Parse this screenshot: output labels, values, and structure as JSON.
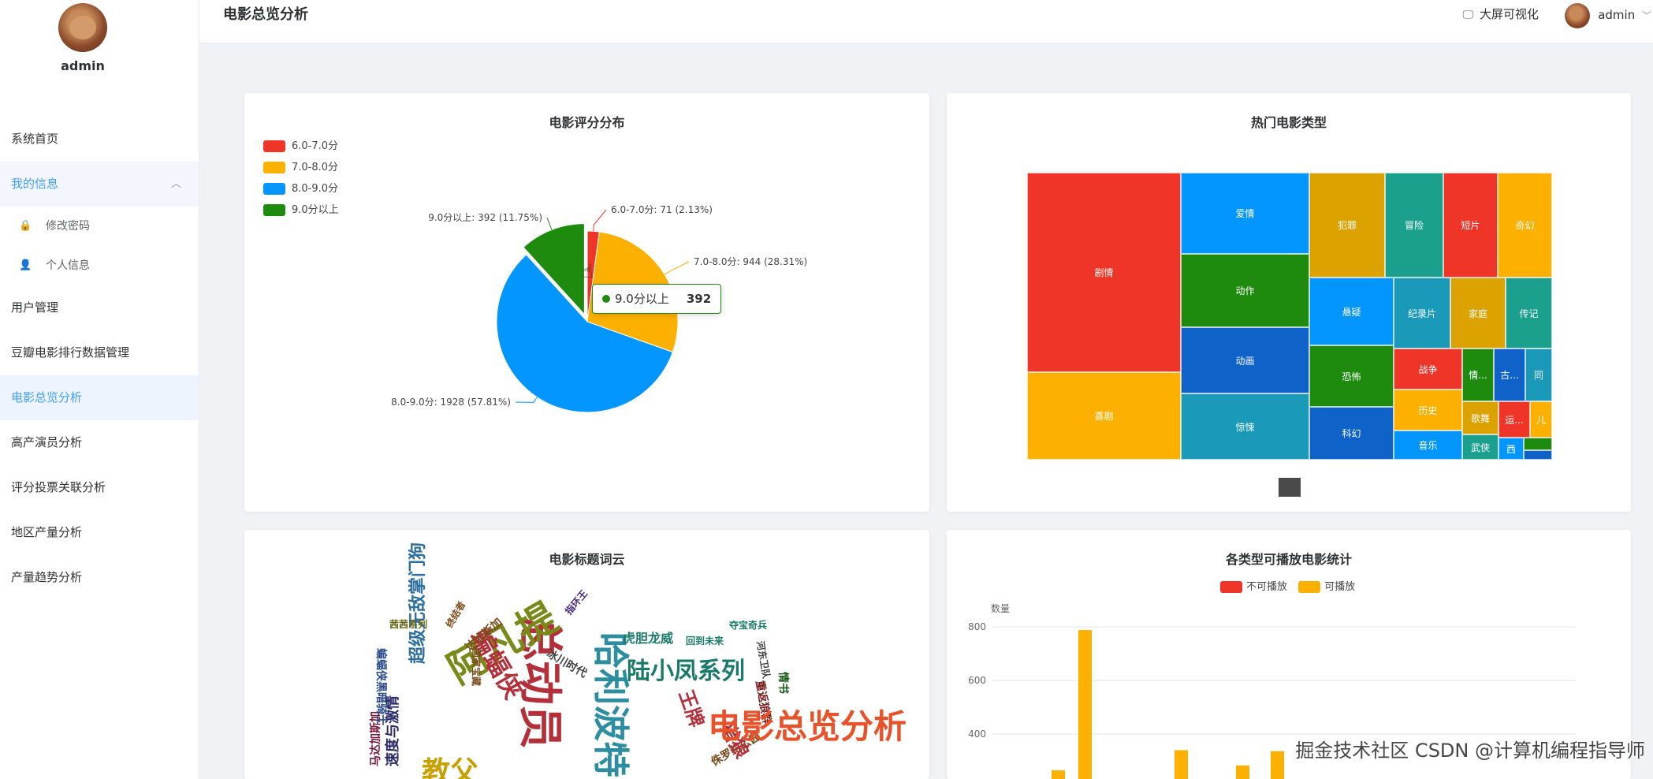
{
  "sidebar": {
    "username": "admin",
    "menu": [
      {
        "label": "系统首页"
      },
      {
        "label": "我的信息"
      },
      {
        "label": "修改密码"
      },
      {
        "label": "个人信息"
      },
      {
        "label": "用户管理"
      },
      {
        "label": "豆瓣电影排行数据管理"
      },
      {
        "label": "电影总览分析"
      },
      {
        "label": "高产演员分析"
      },
      {
        "label": "评分投票关联分析"
      },
      {
        "label": "地区产量分析"
      },
      {
        "label": "产量趋势分析"
      }
    ]
  },
  "header": {
    "title": "电影总览分析",
    "bigscreen_label": "大屏可视化",
    "username": "admin"
  },
  "charts": {
    "rating_title": "电影评分分布",
    "treemap_title": "热门电影类型",
    "wordcloud_title": "电影标题词云",
    "bar_title": "各类型可播放电影统计"
  },
  "chart_data": [
    {
      "type": "pie",
      "title": "电影评分分布",
      "legend": [
        "6.0-7.0分",
        "7.0-8.0分",
        "8.0-9.0分",
        "9.0分以上"
      ],
      "slices": [
        {
          "name": "6.0-7.0分",
          "value": 71,
          "percent": 2.13,
          "color": "#ee3527",
          "label": "6.0-7.0分: 71 (2.13%)"
        },
        {
          "name": "7.0-8.0分",
          "value": 944,
          "percent": 28.31,
          "color": "#fcb100",
          "label": "7.0-8.0分: 944 (28.31%)"
        },
        {
          "name": "8.0-9.0分",
          "value": 1928,
          "percent": 57.81,
          "color": "#0496ff",
          "label": "8.0-9.0分: 1928 (57.81%)"
        },
        {
          "name": "9.0分以上",
          "value": 392,
          "percent": 11.75,
          "color": "#1e8b0f",
          "label": "9.0分以上: 392 (11.75%)"
        }
      ],
      "tooltip": {
        "name": "9.0分以上",
        "value": "392"
      }
    },
    {
      "type": "treemap",
      "title": "热门电影类型",
      "items": [
        "剧情",
        "喜剧",
        "爱情",
        "动作",
        "动画",
        "惊悚",
        "犯罪",
        "冒险",
        "短片",
        "奇幻",
        "悬疑",
        "纪录片",
        "家庭",
        "传记",
        "恐怖",
        "科幻",
        "战争",
        "历史",
        "情...",
        "古...",
        "同",
        "音乐",
        "歌舞",
        "运...",
        "儿",
        "武侠",
        "西"
      ]
    },
    {
      "type": "wordcloud",
      "title": "电影标题词云",
      "words": [
        "总动员",
        "哈利波特",
        "阿凡提",
        "陆小凤系列",
        "蝙蝠侠",
        "超级无敌掌门狗",
        "虎胆龙威",
        "夺宝奇兵",
        "回到未来",
        "冰川时代",
        "达加斯加",
        "指环王",
        "终结者",
        "茜茜系列",
        "速度与激情",
        "教父",
        "马达加斯加",
        "侏罗纪公园",
        "河东卫队",
        "重返狼群",
        "王牌",
        "蝙蝠侠黑暗骑士",
        "国家宝藏",
        "情书",
        "猎狼"
      ]
    },
    {
      "type": "bar",
      "title": "各类型可播放电影统计",
      "legend": [
        "不可播放",
        "可播放"
      ],
      "ylabel": "数量",
      "yticks": [
        400,
        600,
        800
      ],
      "series": [
        {
          "name": "不可播放",
          "color": "#ee3527",
          "values": [
            0,
            0,
            0,
            0,
            0,
            0
          ]
        },
        {
          "name": "可播放",
          "color": "#fcb100",
          "values": [
            265,
            788,
            340,
            283,
            336,
            0
          ]
        }
      ]
    }
  ],
  "overlay": {
    "title": "电影总览分析",
    "watermark": "CSDN @计算机编程指导师",
    "watermark_prefix": "掘金技术社区"
  }
}
